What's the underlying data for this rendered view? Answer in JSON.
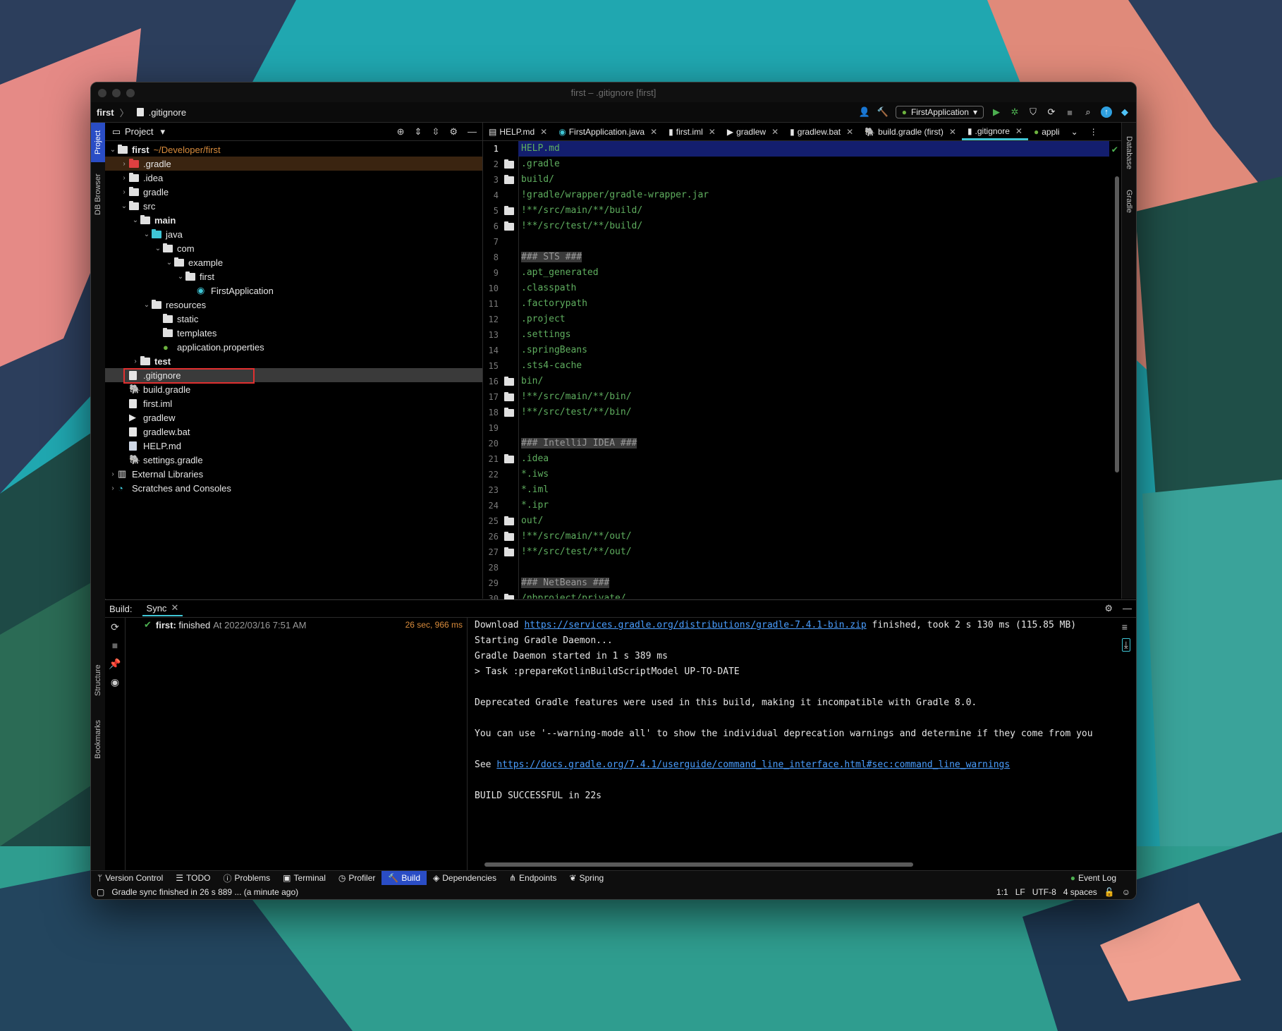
{
  "window": {
    "title": "first – .gitignore [first]"
  },
  "navbar": {
    "project": "first",
    "file": ".gitignore",
    "run_config": "FirstApplication"
  },
  "project_panel": {
    "title": "Project",
    "tree": [
      {
        "label": "first",
        "extra": "~/Developer/first"
      },
      {
        "label": ".gradle"
      },
      {
        "label": ".idea"
      },
      {
        "label": "gradle"
      },
      {
        "label": "src"
      },
      {
        "label": "main"
      },
      {
        "label": "java"
      },
      {
        "label": "com"
      },
      {
        "label": "example"
      },
      {
        "label": "first"
      },
      {
        "label": "FirstApplication"
      },
      {
        "label": "resources"
      },
      {
        "label": "static"
      },
      {
        "label": "templates"
      },
      {
        "label": "application.properties"
      },
      {
        "label": "test"
      },
      {
        "label": ".gitignore"
      },
      {
        "label": "build.gradle"
      },
      {
        "label": "first.iml"
      },
      {
        "label": "gradlew"
      },
      {
        "label": "gradlew.bat"
      },
      {
        "label": "HELP.md"
      },
      {
        "label": "settings.gradle"
      },
      {
        "label": "External Libraries"
      },
      {
        "label": "Scratches and Consoles"
      }
    ]
  },
  "left_strip": {
    "project": "Project",
    "db_browser": "DB Browser",
    "structure": "Structure",
    "bookmarks": "Bookmarks"
  },
  "right_strip": {
    "database": "Database",
    "gradle": "Gradle"
  },
  "editor": {
    "tabs": [
      "HELP.md",
      "FirstApplication.java",
      "first.iml",
      "gradlew",
      "gradlew.bat",
      "build.gradle (first)",
      ".gitignore",
      "appli"
    ],
    "lines": [
      "HELP.md",
      ".gradle",
      "build/",
      "!gradle/wrapper/gradle-wrapper.jar",
      "!**/src/main/**/build/",
      "!**/src/test/**/build/",
      "",
      "### STS ###",
      ".apt_generated",
      ".classpath",
      ".factorypath",
      ".project",
      ".settings",
      ".springBeans",
      ".sts4-cache",
      "bin/",
      "!**/src/main/**/bin/",
      "!**/src/test/**/bin/",
      "",
      "### IntelliJ IDEA ###",
      ".idea",
      "*.iws",
      "*.iml",
      "*.ipr",
      "out/",
      "!**/src/main/**/out/",
      "!**/src/test/**/out/",
      "",
      "### NetBeans ###",
      "/nbproject/private/"
    ]
  },
  "build": {
    "label": "Build:",
    "tab": "Sync",
    "result": {
      "name": "first:",
      "status": "finished",
      "at": "At 2022/03/16 7:51 AM",
      "time": "26 sec, 966 ms"
    },
    "console": [
      {
        "pre": "Download ",
        "link": "https://services.gradle.org/distributions/gradle-7.4.1-bin.zip",
        "post": " finished, took 2 s 130 ms (115.85 MB)"
      },
      {
        "pre": "Starting Gradle Daemon...",
        "link": "",
        "post": ""
      },
      {
        "pre": "Gradle Daemon started in 1 s 389 ms",
        "link": "",
        "post": ""
      },
      {
        "pre": "> Task :prepareKotlinBuildScriptModel UP-TO-DATE",
        "link": "",
        "post": ""
      },
      {
        "pre": "",
        "link": "",
        "post": ""
      },
      {
        "pre": "Deprecated Gradle features were used in this build, making it incompatible with Gradle 8.0.",
        "link": "",
        "post": ""
      },
      {
        "pre": "",
        "link": "",
        "post": ""
      },
      {
        "pre": "You can use '--warning-mode all' to show the individual deprecation warnings and determine if they come from you",
        "link": "",
        "post": ""
      },
      {
        "pre": "",
        "link": "",
        "post": ""
      },
      {
        "pre": "See ",
        "link": "https://docs.gradle.org/7.4.1/userguide/command_line_interface.html#sec:command_line_warnings",
        "post": ""
      },
      {
        "pre": "",
        "link": "",
        "post": ""
      },
      {
        "pre": "BUILD SUCCESSFUL in 22s",
        "link": "",
        "post": ""
      }
    ]
  },
  "toolwindows": [
    "Version Control",
    "TODO",
    "Problems",
    "Terminal",
    "Profiler",
    "Build",
    "Dependencies",
    "Endpoints",
    "Spring"
  ],
  "event_log": "Event Log",
  "status": {
    "message": "Gradle sync finished in 26 s 889 ... (a minute ago)",
    "position": "1:1",
    "line_sep": "LF",
    "encoding": "UTF-8",
    "indent": "4 spaces"
  }
}
